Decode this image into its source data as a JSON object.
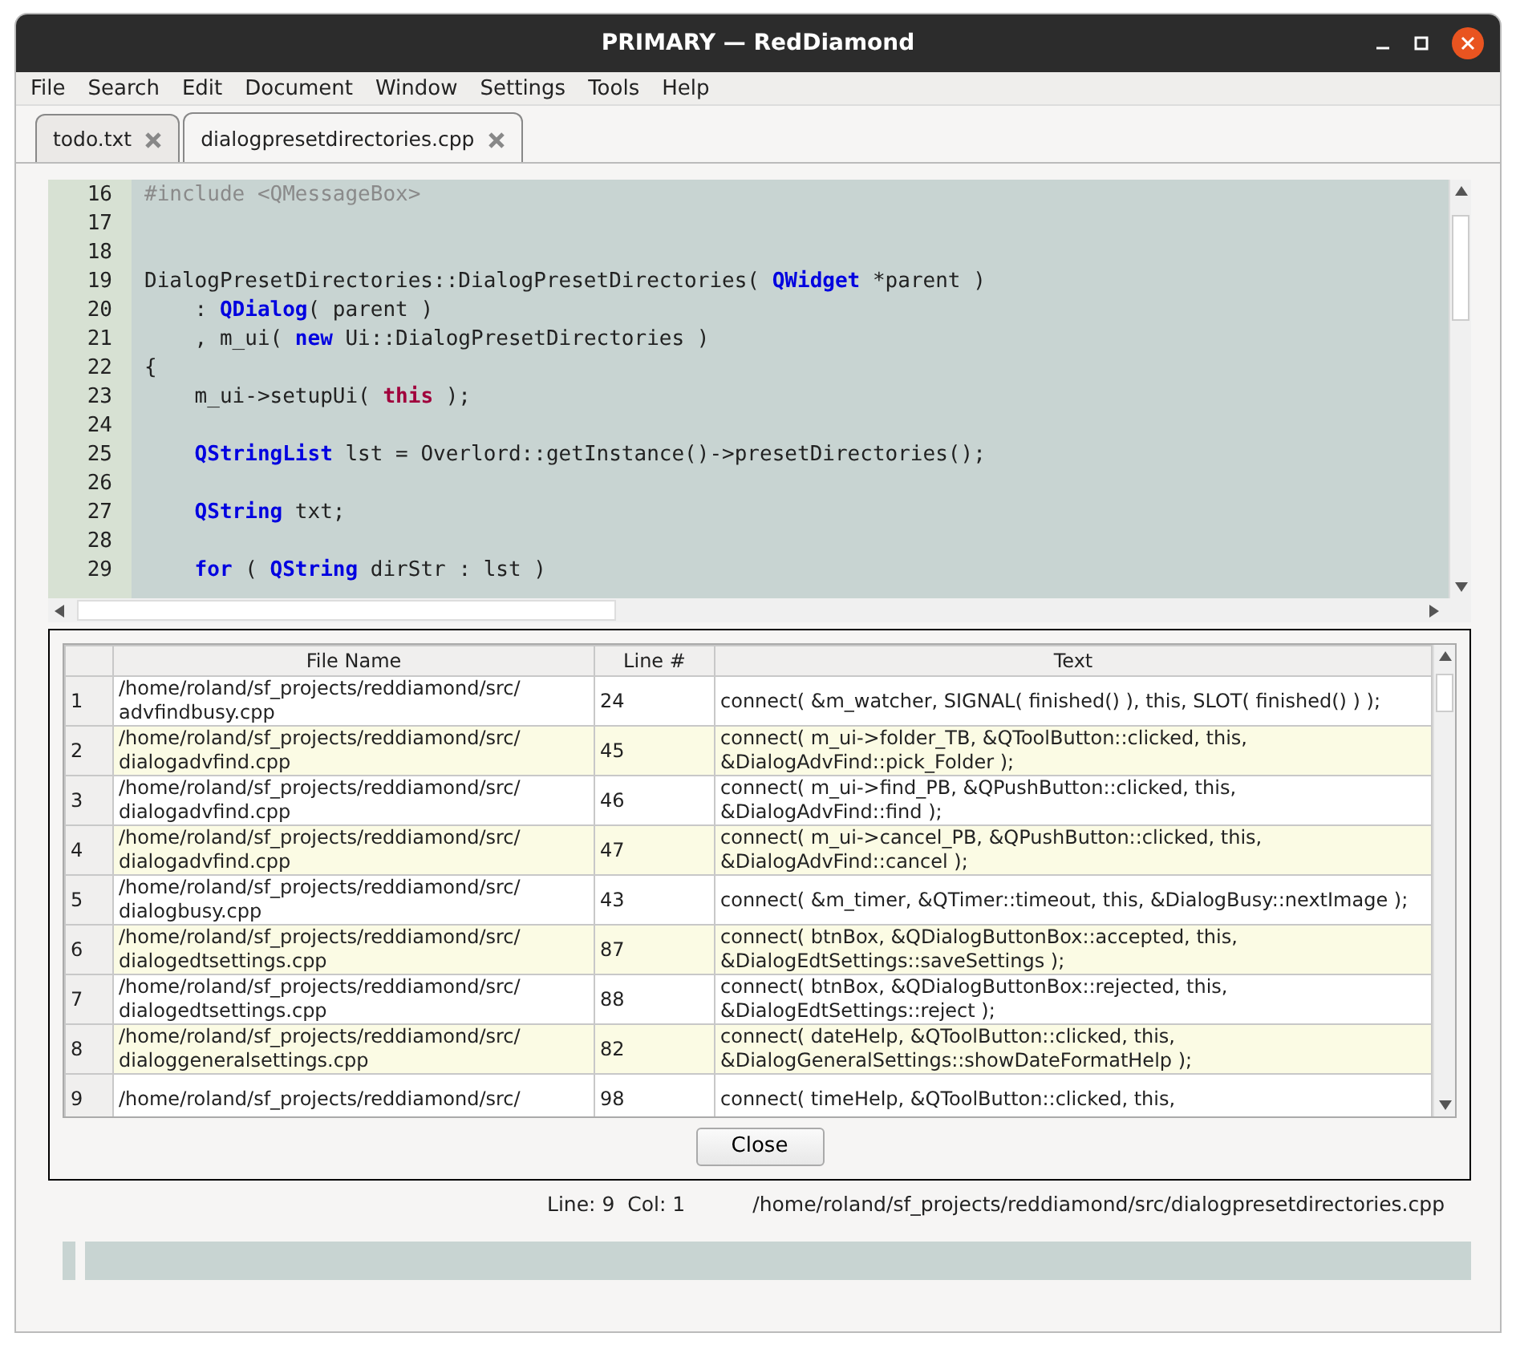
{
  "window": {
    "title": "PRIMARY — RedDiamond"
  },
  "menu": [
    "File",
    "Search",
    "Edit",
    "Document",
    "Window",
    "Settings",
    "Tools",
    "Help"
  ],
  "tabs": [
    {
      "label": "todo.txt",
      "selected": false
    },
    {
      "label": "dialogpresetdirectories.cpp",
      "selected": true
    }
  ],
  "editor": {
    "lines": [
      {
        "number": "16",
        "tokens": [
          {
            "text": "#include <QMessageBox>",
            "kind": "preprocessor"
          }
        ]
      },
      {
        "number": "17"
      },
      {
        "number": "18"
      },
      {
        "number": "19",
        "tokens": [
          {
            "text": "DialogPresetDirectories::DialogPresetDirectories( ",
            "kind": "plain"
          },
          {
            "text": "QWidget",
            "kind": "type"
          },
          {
            "text": " *parent )",
            "kind": "plain"
          }
        ]
      },
      {
        "number": "20",
        "tokens": [
          {
            "text": "    : ",
            "kind": "plain"
          },
          {
            "text": "QDialog",
            "kind": "type"
          },
          {
            "text": "( parent )",
            "kind": "plain"
          }
        ]
      },
      {
        "number": "21",
        "tokens": [
          {
            "text": "    , m_ui( ",
            "kind": "plain"
          },
          {
            "text": "new",
            "kind": "keyword"
          },
          {
            "text": " Ui::DialogPresetDirectories )",
            "kind": "plain"
          }
        ]
      },
      {
        "number": "22",
        "tokens": [
          {
            "text": "{",
            "kind": "plain"
          }
        ]
      },
      {
        "number": "23",
        "tokens": [
          {
            "text": "    m_ui->setupUi( ",
            "kind": "plain"
          },
          {
            "text": "this",
            "kind": "self"
          },
          {
            "text": " );",
            "kind": "plain"
          }
        ]
      },
      {
        "number": "24"
      },
      {
        "number": "25",
        "tokens": [
          {
            "text": "    QStringList",
            "kind": "type"
          },
          {
            "text": " lst = Overlord::getInstance()->presetDirectories();",
            "kind": "plain"
          }
        ]
      },
      {
        "number": "26"
      },
      {
        "number": "27",
        "tokens": [
          {
            "text": "    QString",
            "kind": "type"
          },
          {
            "text": " txt;",
            "kind": "plain"
          }
        ]
      },
      {
        "number": "28"
      },
      {
        "number": "29",
        "tokens": [
          {
            "text": "    for",
            "kind": "keyword"
          },
          {
            "text": " ( ",
            "kind": "plain"
          },
          {
            "text": "QString",
            "kind": "type"
          },
          {
            "text": " dirStr : lst )",
            "kind": "plain"
          }
        ]
      }
    ]
  },
  "results": {
    "columns": [
      "File Name",
      "Line #",
      "Text"
    ],
    "rows": [
      {
        "index": "1",
        "file": "/home/roland/sf_projects/reddiamond/src/ advfindbusy.cpp",
        "line": "24",
        "text": "connect( &m_watcher, SIGNAL( finished() ), this, SLOT( finished() ) );"
      },
      {
        "index": "2",
        "file": "/home/roland/sf_projects/reddiamond/src/ dialogadvfind.cpp",
        "line": "45",
        "text": "connect( m_ui->folder_TB, &QToolButton::clicked, this, &DialogAdvFind::pick_Folder );"
      },
      {
        "index": "3",
        "file": "/home/roland/sf_projects/reddiamond/src/ dialogadvfind.cpp",
        "line": "46",
        "text": "connect( m_ui->find_PB,   &QPushButton::clicked, this, &DialogAdvFind::find );"
      },
      {
        "index": "4",
        "file": "/home/roland/sf_projects/reddiamond/src/ dialogadvfind.cpp",
        "line": "47",
        "text": "connect( m_ui->cancel_PB, &QPushButton::clicked, this, &DialogAdvFind::cancel );"
      },
      {
        "index": "5",
        "file": "/home/roland/sf_projects/reddiamond/src/ dialogbusy.cpp",
        "line": "43",
        "text": "connect( &m_timer, &QTimer::timeout, this, &DialogBusy::nextImage );"
      },
      {
        "index": "6",
        "file": "/home/roland/sf_projects/reddiamond/src/ dialogedtsettings.cpp",
        "line": "87",
        "text": "connect( btnBox, &QDialogButtonBox::accepted, this, &DialogEdtSettings::saveSettings );"
      },
      {
        "index": "7",
        "file": "/home/roland/sf_projects/reddiamond/src/ dialogedtsettings.cpp",
        "line": "88",
        "text": "connect( btnBox, &QDialogButtonBox::rejected, this, &DialogEdtSettings::reject );"
      },
      {
        "index": "8",
        "file": "/home/roland/sf_projects/reddiamond/src/ dialoggeneralsettings.cpp",
        "line": "82",
        "text": "connect( dateHelp, &QToolButton::clicked, this, &DialogGeneralSettings::showDateFormatHelp );"
      },
      {
        "index": "9",
        "file": "/home/roland/sf_projects/reddiamond/src/",
        "line": "98",
        "text": "connect( timeHelp, &QToolButton::clicked, this,"
      }
    ],
    "close_button": "Close"
  },
  "status_bar": {
    "position": "Line: 9  Col: 1",
    "path": "/home/roland/sf_projects/reddiamond/src/dialogpresetdirectories.cpp"
  }
}
